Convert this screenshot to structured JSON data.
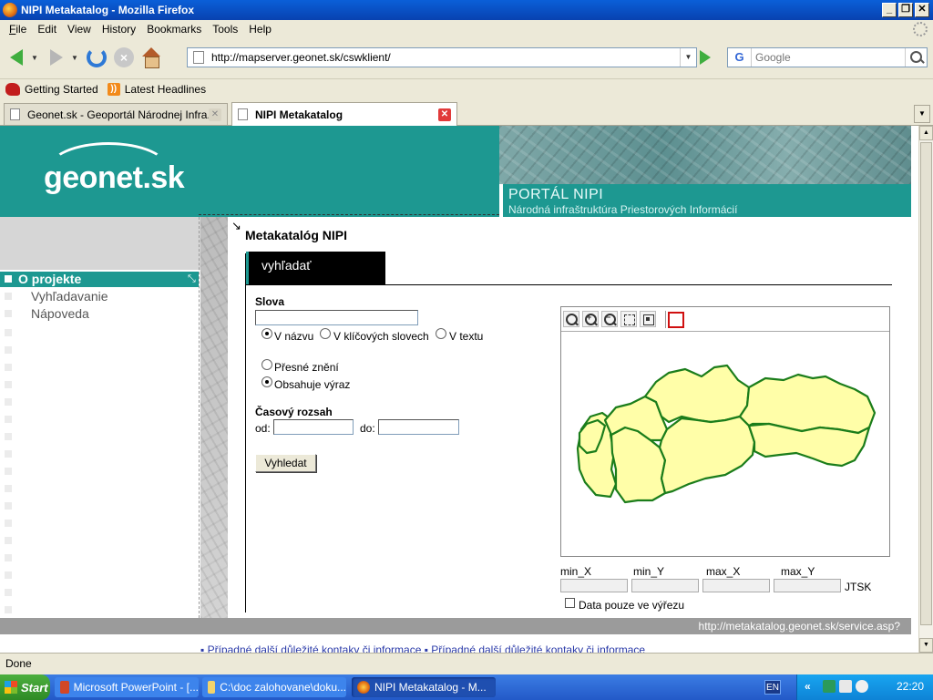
{
  "window": {
    "title": "NIPI Metakatalog - Mozilla Firefox",
    "controls": {
      "minimize": "_",
      "maximize": "❐",
      "close": "✕"
    }
  },
  "menu": [
    "File",
    "Edit",
    "View",
    "History",
    "Bookmarks",
    "Tools",
    "Help"
  ],
  "menu_accel": [
    "F",
    "E",
    "V",
    "s",
    "B",
    "T",
    "H"
  ],
  "nav": {
    "url": "http://mapserver.geonet.sk/cswklient/",
    "search_engine": "G",
    "search_placeholder": "Google"
  },
  "bookmarks": [
    "Getting Started",
    "Latest Headlines"
  ],
  "tabs": [
    {
      "label": "Geonet.sk - Geoportál Národnej Infra...",
      "active": false
    },
    {
      "label": "NIPI Metakatalog",
      "active": true
    }
  ],
  "page": {
    "logo": "geonet.sk",
    "portal_title": "PORTÁL NIPI",
    "portal_subtitle": "Národná infraštruktúra Priestorových Informácií",
    "sidebar": [
      {
        "label": "O projekte",
        "active": true
      },
      {
        "label": "Vyhľadavanie",
        "active": false
      },
      {
        "label": "Nápoveda",
        "active": false
      }
    ],
    "heading": "Metakatalóg NIPI",
    "search_tab": "vyhľadať",
    "form": {
      "words_label": "Slova",
      "words_value": "",
      "scope_options": [
        {
          "label": "V názvu",
          "checked": true
        },
        {
          "label": "V klíčových slovech",
          "checked": false
        },
        {
          "label": "V textu",
          "checked": false
        }
      ],
      "match_options": [
        {
          "label": "Přesné znění",
          "checked": false
        },
        {
          "label": "Obsahuje výraz",
          "checked": true
        }
      ],
      "time_label": "Časový rozsah",
      "from_label": "od:",
      "to_label": "do:",
      "from_value": "",
      "to_value": "",
      "submit": "Vyhledat"
    },
    "map": {
      "tools": [
        "zoom-in-icon",
        "zoom-in-icon",
        "zoom-out-icon",
        "full-extent-icon",
        "zoom-extent-icon",
        "bbox-icon"
      ],
      "tool_symbols": {
        "zoom_in": "+",
        "zoom_out": "−"
      },
      "coords": {
        "min_x": "min_X",
        "min_y": "min_Y",
        "max_x": "max_X",
        "max_y": "max_Y"
      },
      "crs": "JTSK",
      "clip_checkbox": "Data pouze ve výřezu",
      "region_fill": "#fffea8",
      "border_color": "#1b7d1b"
    },
    "service_url": "http://metakatalog.geonet.sk/service.asp?",
    "footer_links": "▪ Případné další důležité kontaky či informace ▪ Případné další důležité kontaky či informace"
  },
  "status": "Done",
  "taskbar": {
    "start": "Start",
    "tasks": [
      {
        "label": "Microsoft PowerPoint - [...",
        "active": false
      },
      {
        "label": "C:\\doc zalohovane\\doku...",
        "active": false
      },
      {
        "label": "NIPI Metakatalog - M...",
        "active": true
      }
    ],
    "lang": "EN",
    "tray_chevron": "«",
    "clock": "22:20"
  },
  "colors": {
    "accent": "#1d9891",
    "map_region": "#fffea8",
    "map_border": "#1b7d1b"
  }
}
